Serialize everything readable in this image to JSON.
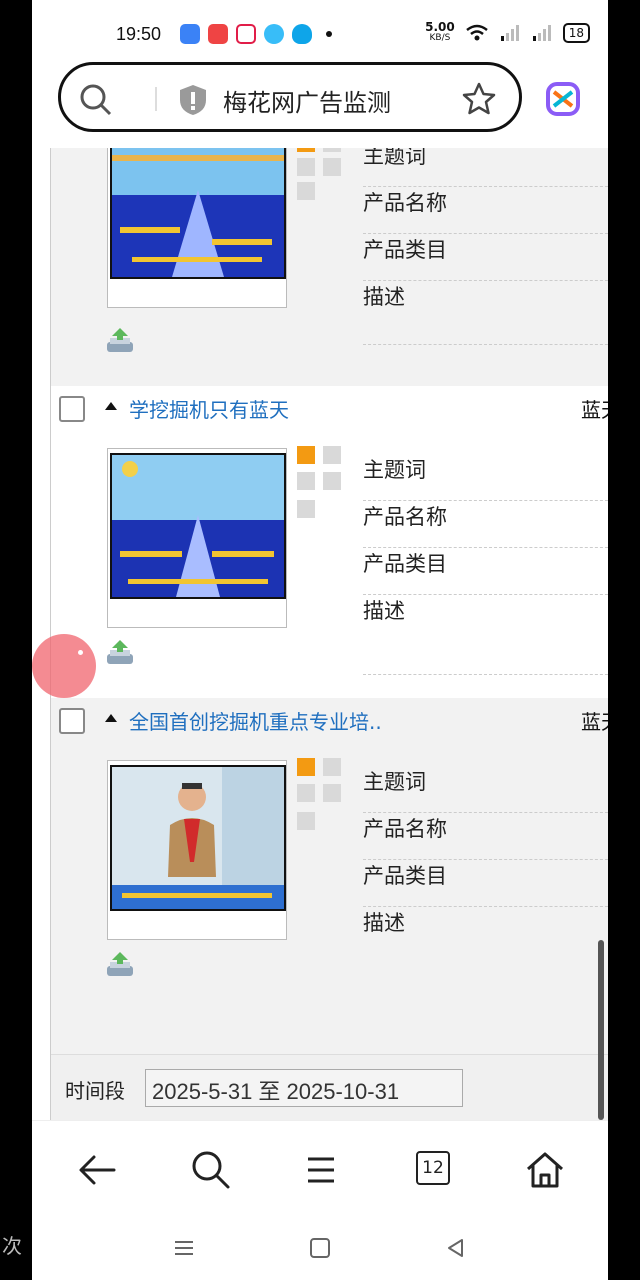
{
  "status_bar": {
    "time": "19:50",
    "net_speed_value": "5.00",
    "net_speed_unit": "KB/S",
    "battery": "18"
  },
  "url_bar": {
    "title": "梅花网广告监测"
  },
  "field_labels": [
    "主题词",
    "产品名称",
    "产品类目",
    "描述"
  ],
  "ads": [
    {
      "title": "",
      "tag": ""
    },
    {
      "title": "学挖掘机只有蓝天",
      "tag": "蓝天"
    },
    {
      "title": "全国首创挖掘机重点专业培..",
      "tag": "蓝天"
    }
  ],
  "time_filter": {
    "label": "时间段",
    "value": "2025-5-31 至 2025-10-31"
  },
  "bottom_nav": {
    "tabs_count": "12"
  },
  "edge_text": "次"
}
